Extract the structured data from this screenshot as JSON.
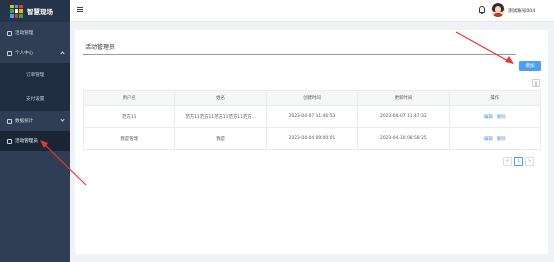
{
  "app": {
    "title": "智慧现场"
  },
  "sidebar": {
    "items": [
      {
        "label": "活动管理",
        "icon": "document-icon"
      },
      {
        "label": "个人中心",
        "icon": "user-card-icon"
      },
      {
        "label": "订单管理"
      },
      {
        "label": "支付设置"
      },
      {
        "label": "数据统计",
        "icon": "chart-icon"
      },
      {
        "label": "活动管理员",
        "icon": "admin-icon"
      }
    ]
  },
  "header": {
    "username": "测试账号004"
  },
  "main": {
    "title": "活动管理员",
    "add_label": "增加",
    "columns_toggle": "‖",
    "table": {
      "headers": [
        "用户名",
        "姓名",
        "创建时间",
        "更新时间",
        "操作"
      ],
      "rows": [
        {
          "username": "范方11",
          "name": "范方11范方11范方11范方11范方...",
          "created": "2023-04-07 11:46:53",
          "updated": "2023-04-07 11:47:32",
          "edit": "编辑",
          "delete": "删除"
        },
        {
          "username": "我是管理",
          "name": "我是",
          "created": "2023-04-04 09:00:01",
          "updated": "2023-04-10 08:58:25",
          "edit": "编辑",
          "delete": "删除"
        }
      ]
    },
    "pagination": {
      "prev": "<",
      "current": "1",
      "next": ">"
    }
  },
  "colors": {
    "sidebar": "#2f3e54",
    "accent": "#4a9ff5",
    "annotation": "#e53935"
  }
}
